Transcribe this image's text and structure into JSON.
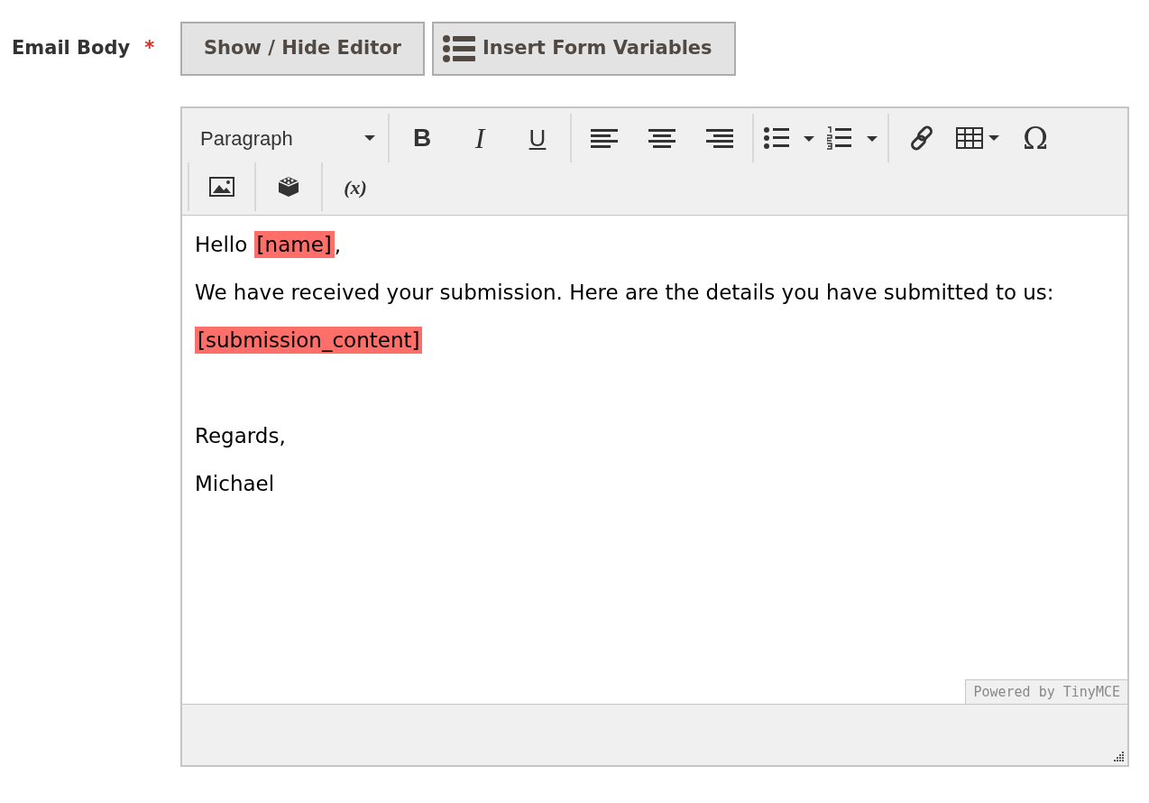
{
  "field": {
    "label": "Email Body",
    "required_mark": "*"
  },
  "buttons": [
    {
      "label": "Show / Hide Editor",
      "kind": "plain"
    },
    {
      "label": "Insert Form Variables",
      "kind": "list"
    }
  ],
  "editor": {
    "format_select": "Paragraph",
    "toolbar": [
      [
        {
          "kind": "bold",
          "text": "B"
        },
        {
          "kind": "italic",
          "text": "I"
        },
        {
          "kind": "underline",
          "text": "U"
        }
      ],
      [
        {
          "kind": "align-left"
        },
        {
          "kind": "align-center"
        },
        {
          "kind": "align-right"
        }
      ],
      [
        {
          "kind": "bullet-list"
        },
        {
          "kind": "numbered-list"
        }
      ],
      [
        {
          "kind": "link"
        },
        {
          "kind": "table"
        },
        {
          "kind": "symbol",
          "text": "Ω"
        }
      ],
      [
        {
          "kind": "image"
        }
      ],
      [
        {
          "kind": "blocks"
        }
      ],
      [
        {
          "kind": "variable",
          "text": "(x)"
        }
      ]
    ],
    "paragraphs": [
      {
        "parts": [
          {
            "text": "Hello "
          },
          {
            "text": "[name]",
            "variable": true
          },
          {
            "text": ","
          }
        ]
      },
      {
        "parts": [
          {
            "text": "We have received your submission. Here are the details you have submitted to us:"
          }
        ]
      },
      {
        "parts": [
          {
            "text": "[submission_content]",
            "variable": true
          }
        ]
      },
      {
        "kind": "empty"
      },
      {
        "parts": [
          {
            "text": "Regards,"
          }
        ]
      },
      {
        "parts": [
          {
            "text": "Michael"
          }
        ]
      }
    ],
    "branding": "Powered by TinyMCE"
  }
}
